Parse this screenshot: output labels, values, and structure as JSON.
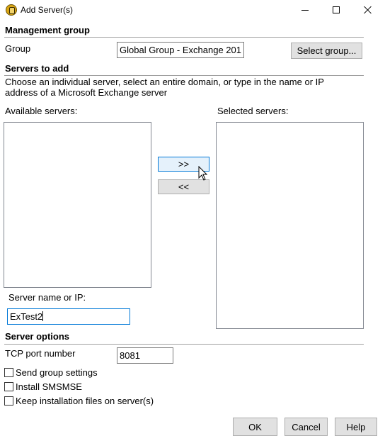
{
  "window": {
    "title": "Add Server(s)"
  },
  "management_group": {
    "heading": "Management group",
    "group_label": "Group",
    "group_value": "Global Group - Exchange 201",
    "select_group_button": "Select group..."
  },
  "servers_to_add": {
    "heading": "Servers to add",
    "description_line1": "Choose an individual server, select an entire domain, or type in the name or IP",
    "description_line2": "address of a Microsoft Exchange server",
    "available_label": "Available servers:",
    "selected_label": "Selected servers:",
    "add_button": ">>",
    "remove_button": "<<",
    "server_name_label": "Server name or IP:",
    "server_name_value": "ExTest2"
  },
  "server_options": {
    "heading": "Server options",
    "tcp_port_label": "TCP port number",
    "tcp_port_value": "8081",
    "checkboxes": [
      {
        "label": "Send group settings",
        "checked": false
      },
      {
        "label": "Install SMSMSE",
        "checked": false
      },
      {
        "label": "Keep installation files on server(s)",
        "checked": false
      }
    ]
  },
  "footer": {
    "ok_label": "OK",
    "cancel_label": "Cancel",
    "help_label": "Help"
  },
  "icons": {
    "app_icon": "exchange-shield-icon",
    "cursor": "mouse-pointer-icon"
  },
  "colors": {
    "focus_border": "#0078d7",
    "hot_button_bg": "#e5f1fb",
    "button_bg": "#e1e1e1"
  }
}
